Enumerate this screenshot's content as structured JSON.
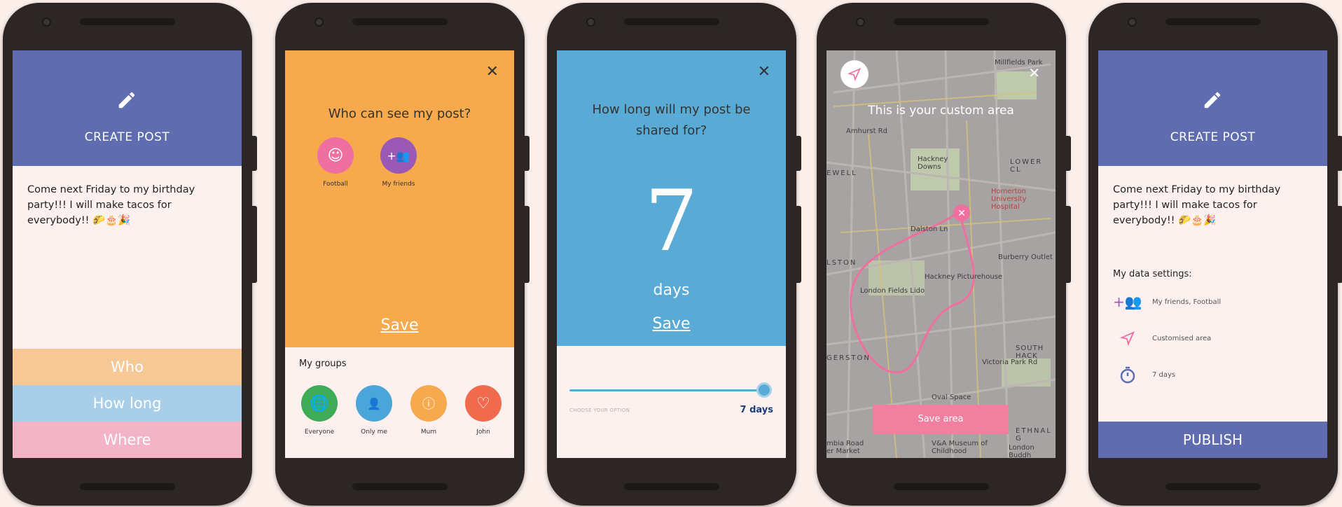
{
  "screen1": {
    "title": "CREATE POST",
    "post_text": "Come next Friday to my birthday party!!! I will make tacos for everybody!! 🌮🎂🎉",
    "options": [
      "Who",
      "How long",
      "Where"
    ]
  },
  "screen2": {
    "question": "Who can see my post?",
    "close": "✕",
    "selected": [
      {
        "label": "Football",
        "color": "#ee6fa0",
        "icon": "smiley-icon"
      },
      {
        "label": "My friends",
        "color": "#9b59b6",
        "icon": "add-group-icon"
      }
    ],
    "save": "Save",
    "groups_title": "My groups",
    "groups": [
      {
        "label": "Everyone",
        "color": "#3faa58",
        "icon": "globe-icon"
      },
      {
        "label": "Only me",
        "color": "#4aa6d8",
        "icon": "person-icon"
      },
      {
        "label": "Mum",
        "color": "#f7aa4d",
        "icon": "info-icon"
      },
      {
        "label": "John",
        "color": "#f06b4d",
        "icon": "heart-icon"
      }
    ]
  },
  "screen3": {
    "question": "How long will my post be shared for?",
    "close": "✕",
    "number": "7",
    "unit": "days",
    "save": "Save",
    "slider_hint": "CHOOSE YOUR OPTION",
    "slider_value": "7 days",
    "slider_fraction": 1.0
  },
  "screen4": {
    "title": "This is your custom area",
    "close": "✕",
    "save_area": "Save area",
    "map_labels": [
      "Millfields Park",
      "Hackney Downs",
      "LOWER CL",
      "Homerton University Hospital",
      "EWELL",
      "Burberry Outlet",
      "LSTON",
      "Hackney Picturehouse",
      "London Fields Lido",
      "GERSTON",
      "SOUTH HACK",
      "Oval Space",
      "V&A Museum of Childhood",
      "London Buddh",
      "mbia Road er Market",
      "Victoria Park Rd",
      "ETHNAL G",
      "Dalston Ln",
      "Amhurst Rd"
    ]
  },
  "screen5": {
    "title": "CREATE POST",
    "post_text": "Come next Friday to my birthday party!!! I will make tacos for everybody!! 🌮🎂🎉",
    "settings_title": "My data settings:",
    "settings": [
      {
        "label": "My friends, Football",
        "icon": "add-group-icon"
      },
      {
        "label": "Customised area",
        "icon": "navigation-arrow-icon"
      },
      {
        "label": "7 days",
        "icon": "stopwatch-icon"
      }
    ],
    "publish": "PUBLISH"
  }
}
